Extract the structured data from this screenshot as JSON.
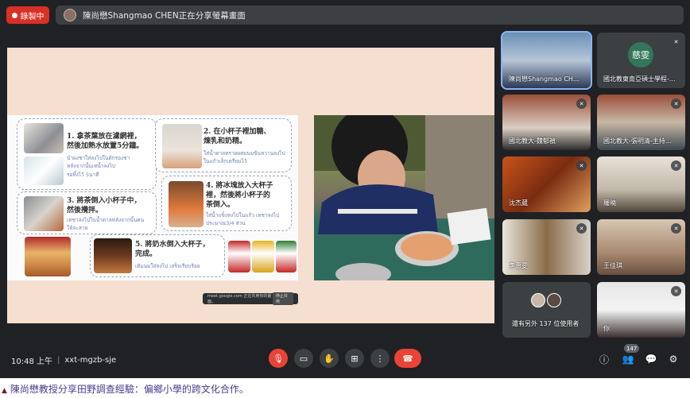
{
  "recording": {
    "label": "錄製中",
    "color": "#d93025"
  },
  "share_banner": {
    "text": "陳尚懋Shangmao CHEN正在分享螢幕畫面"
  },
  "slide": {
    "steps": [
      {
        "title": "1. 拿茶葉放在濾網裡，\n然後加熱水放置5分鐘。",
        "thai": "นำผงชาใส่ลงไปในตักรองชา\nหลังจากนั้นเทน้ำลงไป\nรอทิ้งไว้ 5นาที"
      },
      {
        "title": "2. 在小杯子裡加糖、\n煉乳和奶精。",
        "thai": "ใส่น้ำตาลทรายผสมนมข้นหวานลงไป\nในแก้วเล็กเตรียมไว้"
      },
      {
        "title": "3. 將茶倒入小杯子中，\n然後攪拌。",
        "thai": "เทชาลงไปในน้ำตาลหลังจากนั้นคน\nให้ละลาย"
      },
      {
        "title": "4. 將冰塊放入大杯子\n裡，然後將小杯子的\n茶倒入。",
        "thai": "ใส่น้ำแข็งลงไปในแก้ว เทชาลงไป\nประมาณ3/4 ส่วน"
      },
      {
        "title": "5. 將奶水倒入大杯子，\n完成。",
        "thai": "เติมนมใส่ลงไป เสร็จเรียบร้อย"
      }
    ],
    "snackbar": {
      "text": "meet.google.com 正在共用你的畫面。",
      "button": "停止共用"
    }
  },
  "participants": [
    {
      "name": "陳尚懋Shangmao CH...",
      "muted": false,
      "active": true
    },
    {
      "name": "國北教東南亞碩士學程-...",
      "muted": true,
      "avatar": "慈雯"
    },
    {
      "name": "國北教大-魏郁禎",
      "muted": true
    },
    {
      "name": "國北教大-張明清-主持...",
      "muted": true
    },
    {
      "name": "沈杰葳",
      "muted": true
    },
    {
      "name": "羅曉",
      "muted": true
    },
    {
      "name": "李惠雯",
      "muted": true
    },
    {
      "name": "王佳琪",
      "muted": true
    },
    {
      "name": "還有另外 137 位使用者",
      "muted": false
    },
    {
      "name": "你",
      "muted": true
    }
  ],
  "meeting": {
    "time": "10:48 上午",
    "separator": "|",
    "code": "xxt-mgzb-sje"
  },
  "people_count": "147",
  "caption": "陳尚懋教授分享田野調查經驗：偏鄉小學的跨文化合作。",
  "colors": {
    "end_call": "#ea4335",
    "active_outline": "#8ab4f8"
  }
}
